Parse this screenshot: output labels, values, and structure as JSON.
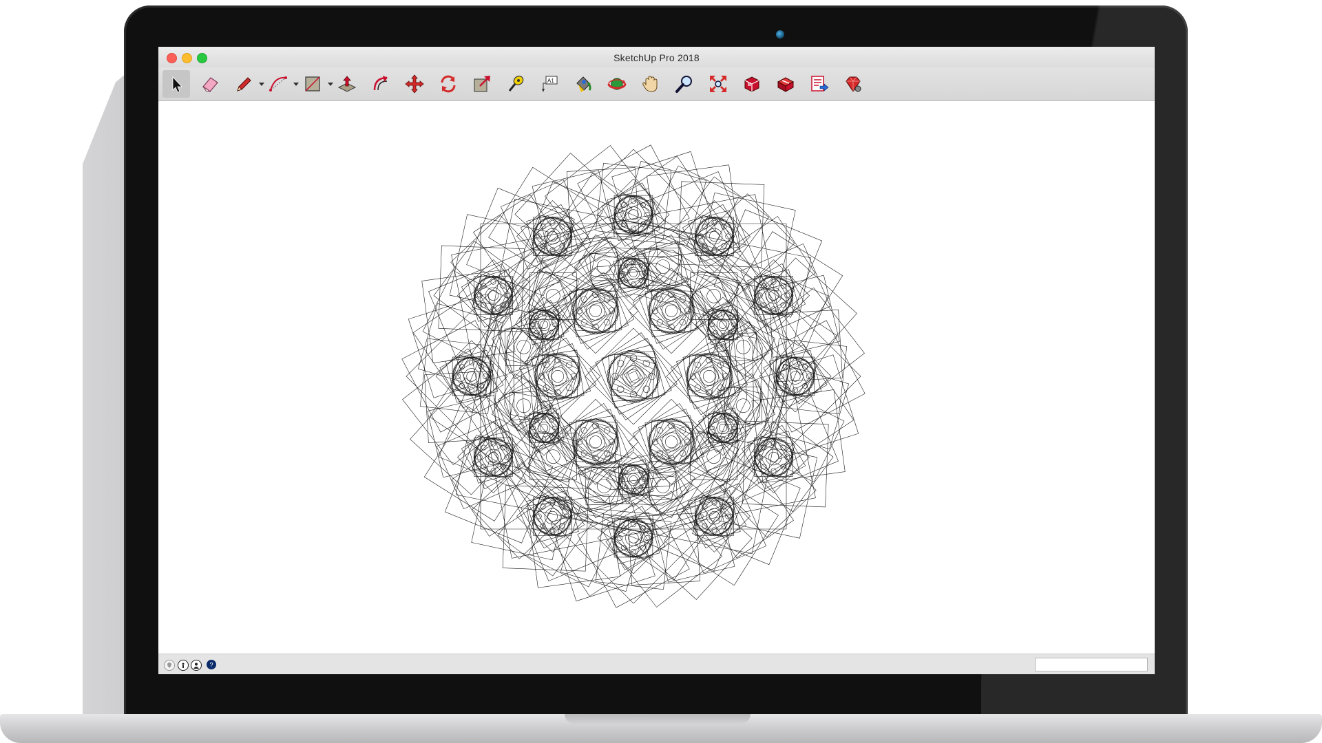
{
  "window": {
    "title": "SketchUp Pro 2018"
  },
  "toolbar": {
    "tools": [
      {
        "name": "select-tool",
        "icon": "arrow-cursor-icon",
        "active": true
      },
      {
        "name": "eraser-tool",
        "icon": "eraser-icon"
      },
      {
        "name": "line-tool",
        "icon": "pencil-icon",
        "dropdown": true
      },
      {
        "name": "arc-tool",
        "icon": "arc-icon",
        "dropdown": true
      },
      {
        "name": "rectangle-tool",
        "icon": "rectangle-icon",
        "dropdown": true
      },
      {
        "name": "push-pull-tool",
        "icon": "push-pull-icon"
      },
      {
        "name": "offset-tool",
        "icon": "offset-icon"
      },
      {
        "name": "move-tool",
        "icon": "move-arrows-icon"
      },
      {
        "name": "rotate-tool",
        "icon": "rotate-icon"
      },
      {
        "name": "scale-tool",
        "icon": "scale-icon"
      },
      {
        "name": "tape-measure-tool",
        "icon": "tape-measure-icon"
      },
      {
        "name": "text-tool",
        "icon": "text-label-icon",
        "label": "A1"
      },
      {
        "name": "paint-bucket-tool",
        "icon": "paint-bucket-icon"
      },
      {
        "name": "orbit-tool",
        "icon": "orbit-icon"
      },
      {
        "name": "pan-tool",
        "icon": "hand-icon"
      },
      {
        "name": "zoom-tool",
        "icon": "magnifier-icon"
      },
      {
        "name": "zoom-extents-tool",
        "icon": "zoom-extents-icon"
      },
      {
        "name": "3d-warehouse-tool",
        "icon": "warehouse-icon"
      },
      {
        "name": "extension-warehouse-tool",
        "icon": "extension-warehouse-icon"
      },
      {
        "name": "send-to-layout-tool",
        "icon": "layout-send-icon"
      },
      {
        "name": "extension-manager-tool",
        "icon": "ruby-gem-icon"
      }
    ]
  },
  "statusbar": {
    "icons": [
      "geo-location-icon",
      "credits-icon",
      "user-icon",
      "help-icon"
    ],
    "measurements_value": ""
  },
  "colors": {
    "accent_red": "#c8102e",
    "line_color": "#1a1a1a"
  }
}
